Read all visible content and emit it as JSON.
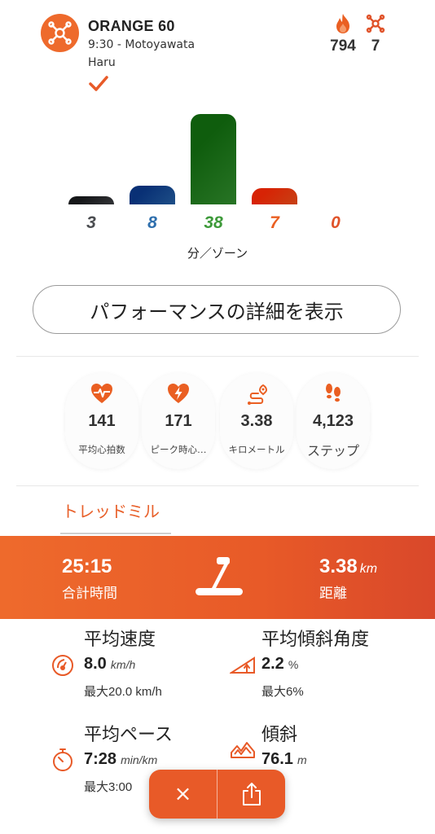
{
  "header": {
    "class_name": "ORANGE 60",
    "subtitle": "9:30 - Motoyawata",
    "coach": "Haru",
    "calories": "794",
    "splat_points": "7",
    "icons": {
      "logo": "orangetheory-logo-icon",
      "calories": "flame-icon",
      "splat": "splat-icon",
      "check": "checkmark-icon"
    }
  },
  "chart_data": {
    "type": "bar",
    "categories": [
      "zone-1",
      "zone-2",
      "zone-3",
      "zone-4",
      "zone-5"
    ],
    "values": [
      3,
      8,
      38,
      7,
      0
    ],
    "colors": [
      "#4a4c50",
      "#2f6fad",
      "#3e9a3a",
      "#ea5f22",
      "#e0532a"
    ],
    "xlabel": "分／ゾーン",
    "ylim": [
      0,
      40
    ]
  },
  "zone_labels": [
    "3",
    "8",
    "38",
    "7",
    "0"
  ],
  "performance_button": "パフォーマンスの詳細を表示",
  "metrics": [
    {
      "icon": "heart-rate-icon",
      "value": "141",
      "label": "平均心拍数"
    },
    {
      "icon": "heart-bolt-icon",
      "value": "171",
      "label": "ピーク時心…"
    },
    {
      "icon": "route-distance-icon",
      "value": "3.38",
      "label": "キロメートル"
    },
    {
      "icon": "footsteps-icon",
      "value": "4,123",
      "label": "ステップ"
    }
  ],
  "tab": "トレッドミル",
  "banner": {
    "total_time_value": "25:15",
    "total_time_label": "合計時間",
    "distance_value": "3.38",
    "distance_unit": "km",
    "distance_label": "距離",
    "icon": "treadmill-icon"
  },
  "details": {
    "avg_speed": {
      "title": "平均速度",
      "value": "8.0",
      "unit": "km/h",
      "sub": "最大20.0 km/h",
      "icon": "speedometer-icon"
    },
    "avg_incline": {
      "title": "平均傾斜角度",
      "value": "2.2",
      "unit": "%",
      "sub": "最大6%",
      "icon": "incline-angle-icon"
    },
    "avg_pace": {
      "title": "平均ペース",
      "value": "7:28",
      "unit": "min/km",
      "sub": "最大3:00",
      "icon": "stopwatch-icon"
    },
    "elevation": {
      "title": "傾斜",
      "value": "76.1",
      "unit": "m",
      "icon": "elevation-chart-icon"
    }
  },
  "actions": {
    "close_symbol": "×",
    "close_icon": "close-icon",
    "share_icon": "share-icon"
  },
  "colors": {
    "accent": "#ee6a2c",
    "green": "#3e9a3a",
    "blue": "#2f6fad",
    "gray": "#4a4c50",
    "check": "#e85a28"
  }
}
